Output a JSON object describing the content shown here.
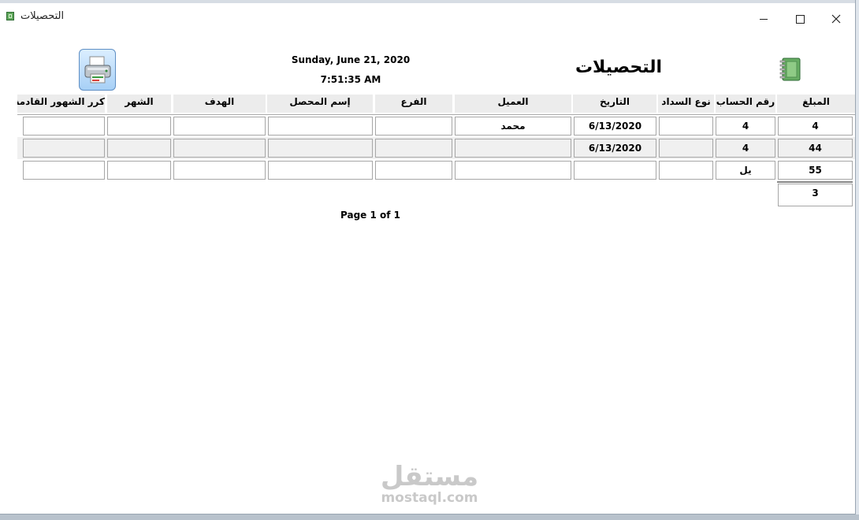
{
  "window": {
    "title": "التحصيلات"
  },
  "report": {
    "title": "التحصيلات",
    "date": "Sunday, June 21, 2020",
    "time": "7:51:35 AM",
    "page_info": "Page 1 of 1"
  },
  "columns": [
    {
      "key": "amount",
      "label": "المبلغ"
    },
    {
      "key": "account",
      "label": "رقم الحساب"
    },
    {
      "key": "pay_type",
      "label": "نوع السداد"
    },
    {
      "key": "date",
      "label": "التاريخ"
    },
    {
      "key": "client",
      "label": "العميل"
    },
    {
      "key": "branch",
      "label": "الفرع"
    },
    {
      "key": "collector",
      "label": "إسم المحصل"
    },
    {
      "key": "target",
      "label": "الهدف"
    },
    {
      "key": "month",
      "label": "الشهر"
    },
    {
      "key": "repeat",
      "label": "كرر الشهور القادمة"
    }
  ],
  "rows": [
    [
      "4",
      "4",
      "",
      "6/13/2020",
      "محمد",
      "",
      "",
      "",
      "",
      ""
    ],
    [
      "44",
      "4",
      "",
      "6/13/2020",
      "",
      "",
      "",
      "",
      "",
      ""
    ],
    [
      "55",
      "يل",
      "",
      "",
      "",
      "",
      "",
      "",
      "",
      ""
    ]
  ],
  "footer": {
    "count": "3"
  },
  "watermark": {
    "arabic": "مستقل",
    "latin": "mostaql.com"
  },
  "icons": {
    "window_icon": "notebook-icon",
    "print": "printer-icon",
    "report_icon": "notebook-icon"
  },
  "colors": {
    "header_bg": "#ececec",
    "alt_row_bg": "#f0f0f0",
    "cell_border": "#a6a6a6"
  }
}
